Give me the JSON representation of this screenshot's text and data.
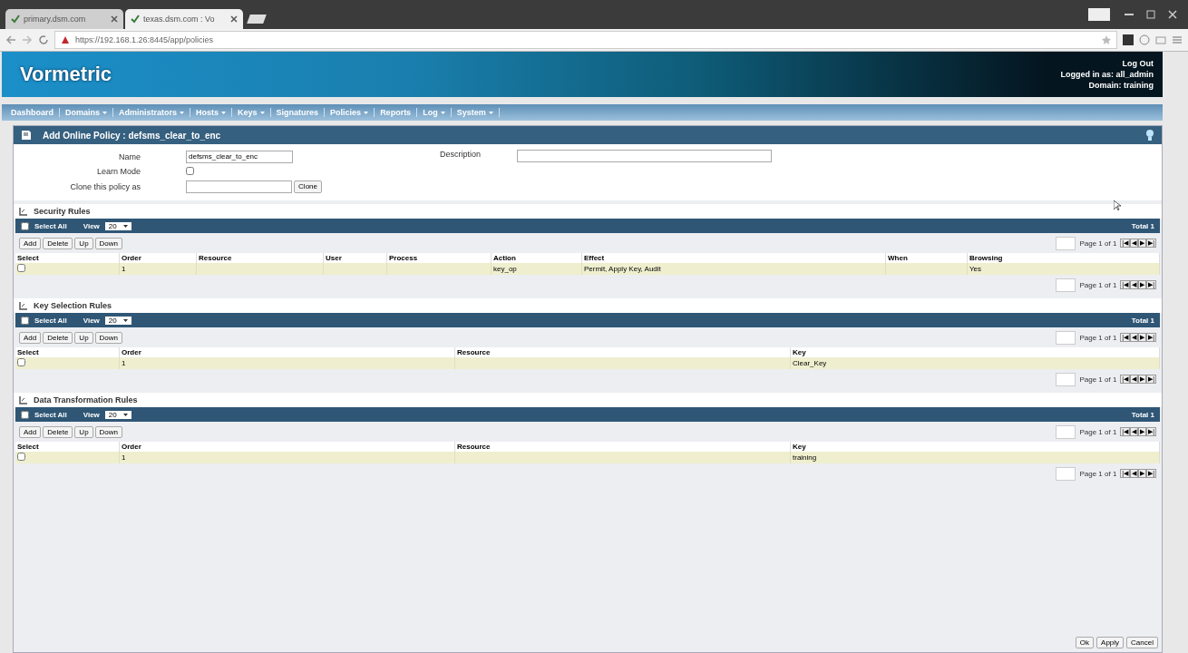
{
  "browser": {
    "tabs": [
      {
        "title": "primary.dsm.com",
        "selected": false
      },
      {
        "title": "texas.dsm.com : Vo",
        "selected": true
      }
    ],
    "address": "https://192.168.1.26:8445/app/policies"
  },
  "header": {
    "logo": "Vormetric",
    "logout": "Log Out",
    "logged_in": "Logged in as: all_admin",
    "domain": "Domain: training"
  },
  "nav": [
    {
      "label": "Dashboard",
      "dropdown": false
    },
    {
      "label": "Domains",
      "dropdown": true
    },
    {
      "label": "Administrators",
      "dropdown": true
    },
    {
      "label": "Hosts",
      "dropdown": true
    },
    {
      "label": "Keys",
      "dropdown": true
    },
    {
      "label": "Signatures",
      "dropdown": false
    },
    {
      "label": "Policies",
      "dropdown": true
    },
    {
      "label": "Reports",
      "dropdown": false
    },
    {
      "label": "Log",
      "dropdown": true
    },
    {
      "label": "System",
      "dropdown": true
    }
  ],
  "panel": {
    "title": "Add Online Policy : defsms_clear_to_enc",
    "form": {
      "name_label": "Name",
      "name_value": "defsms_clear_to_enc",
      "learn_label": "Learn Mode",
      "learn_checked": false,
      "clone_label": "Clone this policy as",
      "clone_button": "Clone",
      "description_label": "Description"
    }
  },
  "sections": [
    {
      "title": "Security Rules",
      "select_all": "Select All",
      "select_all_checked": false,
      "view_label": "View",
      "view_value": "20",
      "total": "Total 1",
      "buttons": [
        "Add",
        "Delete",
        "Up",
        "Down"
      ],
      "pagers": [
        {
          "text": "Page 1 of 1",
          "buttons": [
            "|◀",
            "◀",
            "▶",
            "▶|"
          ]
        },
        {
          "text": "Page 1 of 1",
          "buttons": [
            "|◀",
            "◀",
            "▶",
            "▶|"
          ]
        }
      ],
      "columns": [
        "Select",
        "Order",
        "Resource",
        "User",
        "Process",
        "Action",
        "Effect",
        "When",
        "Browsing"
      ],
      "rows": [
        {
          "checked": false,
          "cells": [
            "",
            "1",
            "",
            "",
            "",
            "key_op",
            "Permit, Apply Key, Audit",
            "",
            "Yes"
          ]
        }
      ]
    },
    {
      "title": "Key Selection Rules",
      "select_all": "Select All",
      "select_all_checked": false,
      "view_label": "View",
      "view_value": "20",
      "total": "Total 1",
      "buttons": [
        "Add",
        "Delete",
        "Up",
        "Down"
      ],
      "pagers": [
        {
          "text": "Page 1 of 1",
          "buttons": [
            "|◀",
            "◀",
            "▶",
            "▶|"
          ]
        },
        {
          "text": "Page 1 of 1",
          "buttons": [
            "|◀",
            "◀",
            "▶",
            "▶|"
          ]
        }
      ],
      "columns": [
        "Select",
        "Order",
        "Resource",
        "Key"
      ],
      "rows": [
        {
          "checked": false,
          "cells": [
            "",
            "1",
            "",
            "Clear_Key"
          ]
        }
      ]
    },
    {
      "title": "Data Transformation Rules",
      "select_all": "Select All",
      "select_all_checked": false,
      "view_label": "View",
      "view_value": "20",
      "total": "Total 1",
      "buttons": [
        "Add",
        "Delete",
        "Up",
        "Down"
      ],
      "pagers": [
        {
          "text": "Page 1 of 1",
          "buttons": [
            "|◀",
            "◀",
            "▶",
            "▶|"
          ]
        },
        {
          "text": "Page 1 of 1",
          "buttons": [
            "|◀",
            "◀",
            "▶",
            "▶|"
          ]
        }
      ],
      "columns": [
        "Select",
        "Order",
        "Resource",
        "Key"
      ],
      "rows": [
        {
          "checked": false,
          "cells": [
            "",
            "1",
            "",
            "training"
          ]
        }
      ]
    }
  ],
  "footer_buttons": [
    "Ok",
    "Apply",
    "Cancel"
  ]
}
